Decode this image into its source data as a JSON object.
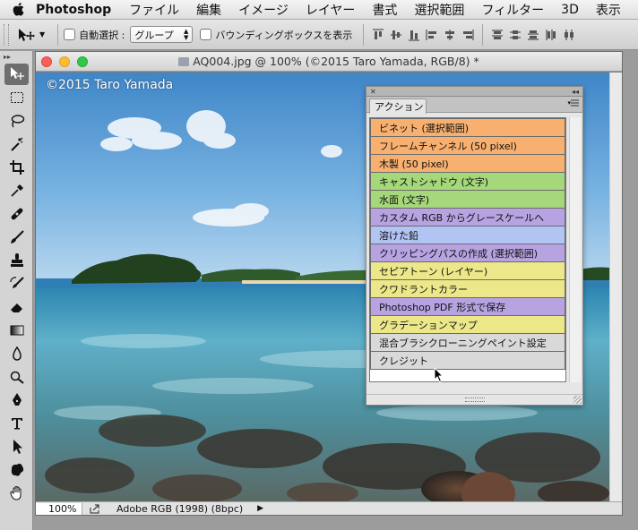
{
  "menubar": {
    "app_name": "Photoshop",
    "items": [
      "ファイル",
      "編集",
      "イメージ",
      "レイヤー",
      "書式",
      "選択範囲",
      "フィルター",
      "3D",
      "表示"
    ]
  },
  "options": {
    "auto_select_label": "自動選択 :",
    "auto_select_value": "グループ",
    "bounding_box_label": "バウンディングボックスを表示"
  },
  "document": {
    "title": "AQ004.jpg @ 100% (©2015 Taro Yamada, RGB/8) *",
    "watermark": "©2015 Taro Yamada",
    "zoom": "100%",
    "color_profile": "Adobe RGB (1998) (8bpc)"
  },
  "actions_panel": {
    "tab_label": "アクション",
    "colors": {
      "orange": "#f7b070",
      "green": "#a4d87a",
      "violet": "#b7a3e2",
      "blue": "#b2c4f4",
      "yellow": "#ece88a",
      "gray": "#d9d9d9"
    },
    "items": [
      {
        "label": "ビネット (選択範囲)",
        "color": "orange"
      },
      {
        "label": "フレームチャンネル (50 pixel)",
        "color": "orange"
      },
      {
        "label": "木製 (50 pixel)",
        "color": "orange"
      },
      {
        "label": "キャストシャドウ (文字)",
        "color": "green"
      },
      {
        "label": "水面 (文字)",
        "color": "green"
      },
      {
        "label": "カスタム RGB からグレースケールへ",
        "color": "violet"
      },
      {
        "label": "溶けた鉛",
        "color": "blue"
      },
      {
        "label": "クリッピングパスの作成 (選択範囲)",
        "color": "violet"
      },
      {
        "label": "セピアトーン (レイヤー)",
        "color": "yellow"
      },
      {
        "label": "クワドラントカラー",
        "color": "yellow"
      },
      {
        "label": "Photoshop PDF 形式で保存",
        "color": "violet"
      },
      {
        "label": "グラデーションマップ",
        "color": "yellow"
      },
      {
        "label": "混合ブラシクローニングペイント設定",
        "color": "gray"
      },
      {
        "label": "クレジット",
        "color": "gray"
      }
    ]
  },
  "tools": [
    {
      "icon": "move-icon",
      "active": true
    },
    {
      "icon": "marquee-icon"
    },
    {
      "icon": "lasso-icon"
    },
    {
      "icon": "magic-wand-icon"
    },
    {
      "icon": "crop-icon"
    },
    {
      "icon": "eyedropper-icon"
    },
    {
      "icon": "healing-brush-icon"
    },
    {
      "icon": "brush-icon"
    },
    {
      "icon": "clone-stamp-icon"
    },
    {
      "icon": "history-brush-icon"
    },
    {
      "icon": "eraser-icon"
    },
    {
      "icon": "gradient-icon"
    },
    {
      "icon": "blur-icon"
    },
    {
      "icon": "dodge-icon"
    },
    {
      "icon": "pen-icon"
    },
    {
      "icon": "type-icon"
    },
    {
      "icon": "path-selection-icon"
    },
    {
      "icon": "custom-shape-icon"
    },
    {
      "icon": "hand-icon"
    }
  ]
}
